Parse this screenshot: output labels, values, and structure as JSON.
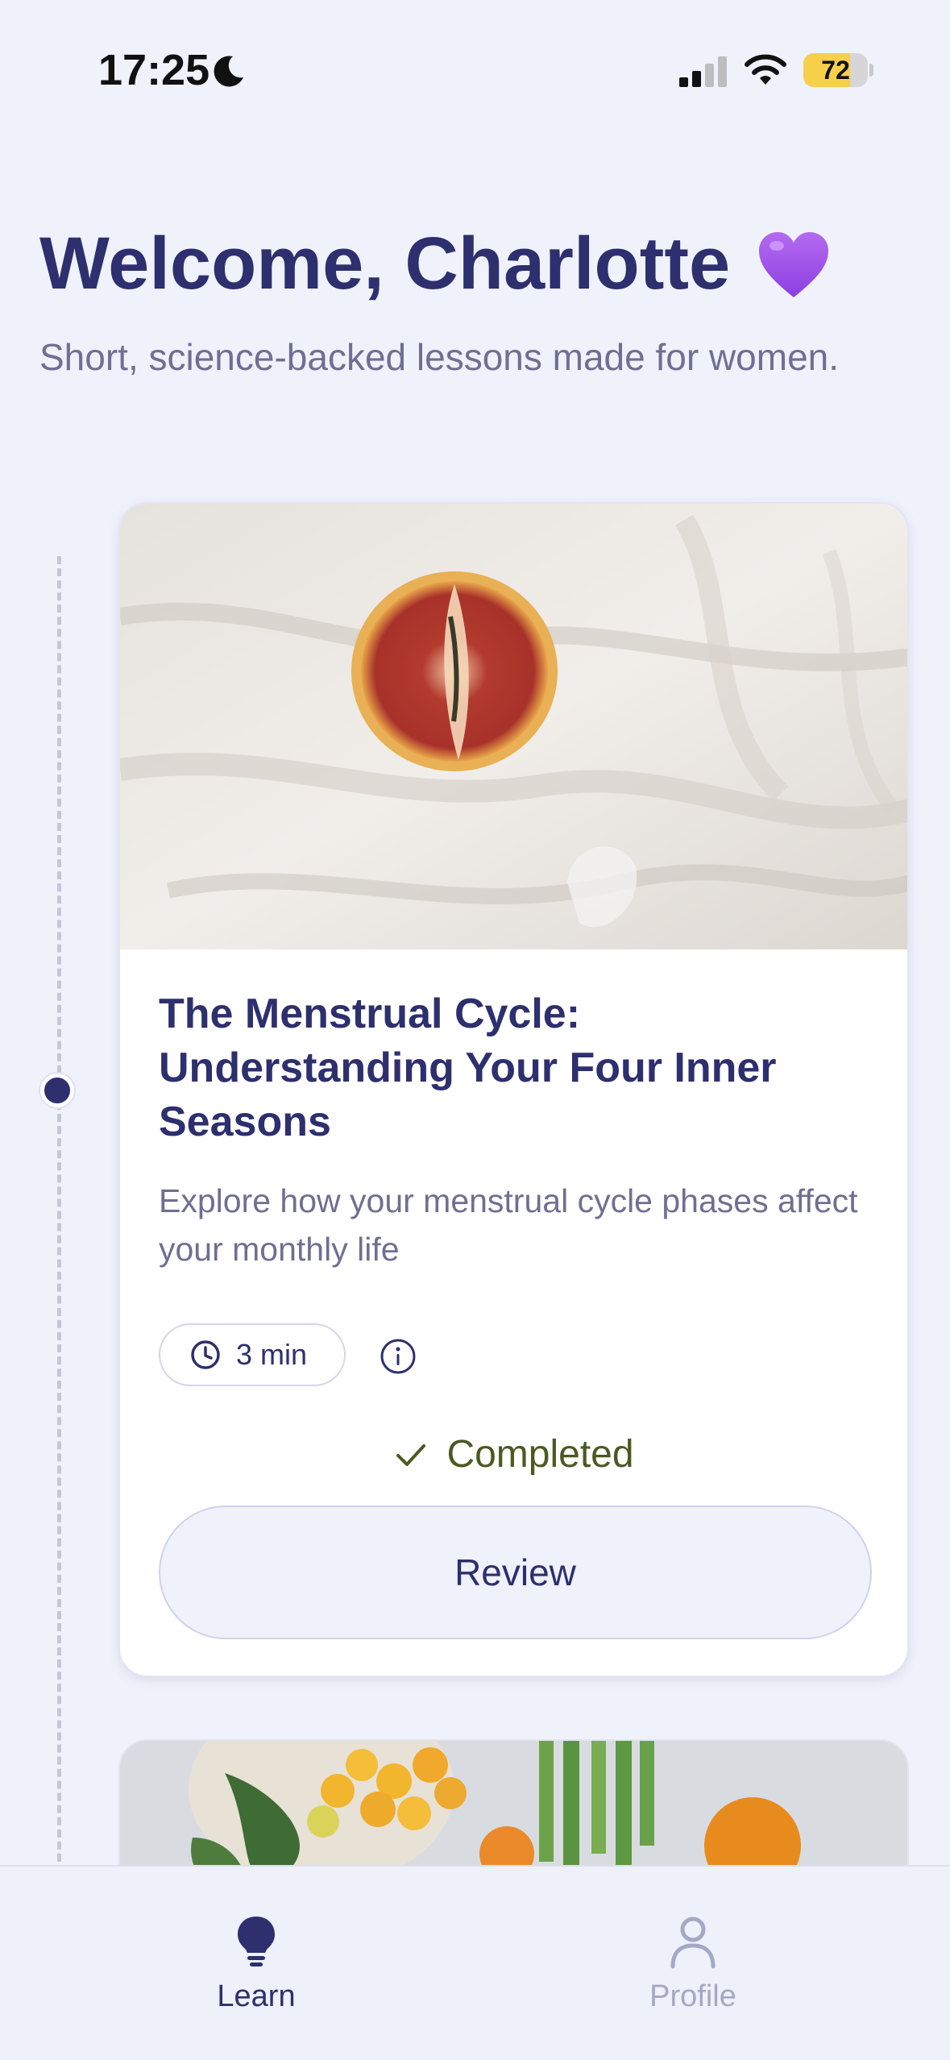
{
  "status_bar": {
    "time": "17:25",
    "battery_level": 72,
    "battery_label": "72",
    "icons": [
      "moon-icon",
      "signal-icon",
      "wifi-icon",
      "battery-icon"
    ]
  },
  "header": {
    "title": "Welcome, Charlotte",
    "title_emoji": "purple-heart",
    "subtitle": "Short, science-backed lessons made for women."
  },
  "lessons": [
    {
      "image": "grapefruit-on-white-sheets",
      "title": "The Menstrual Cycle: Understanding Your Four Inner Seasons",
      "description": "Explore how your menstrual cycle phases affect your monthly life",
      "duration": "3 min",
      "status": "Completed",
      "action": "Review"
    },
    {
      "image": "fresh-vegetables-and-fruit"
    }
  ],
  "tab_bar": {
    "tabs": [
      {
        "label": "Learn",
        "icon": "lightbulb-icon",
        "active": true
      },
      {
        "label": "Profile",
        "icon": "person-icon",
        "active": false
      }
    ]
  },
  "colors": {
    "background": "#eff2fb",
    "primary": "#2d2f6e",
    "muted_text": "#6f6f92",
    "completed": "#4a5a22",
    "battery": "#f7cf4b"
  }
}
